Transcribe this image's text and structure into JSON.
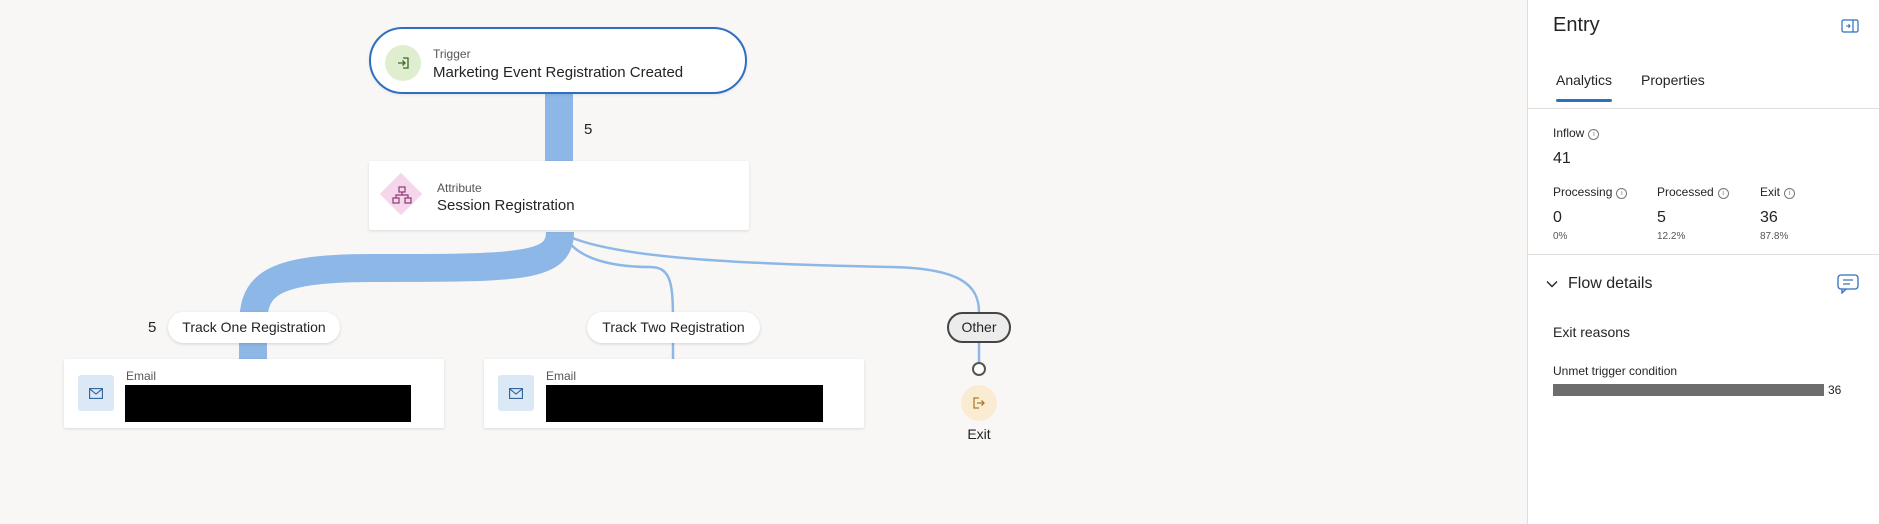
{
  "trigger": {
    "kind": "Trigger",
    "title": "Marketing Event Registration Created",
    "count": "5"
  },
  "attribute": {
    "kind": "Attribute",
    "title": "Session Registration"
  },
  "branches": [
    {
      "label": "Track One Registration",
      "count": "5"
    },
    {
      "label": "Track Two Registration"
    },
    {
      "label": "Other"
    }
  ],
  "emails": [
    {
      "kind": "Email"
    },
    {
      "kind": "Email"
    }
  ],
  "exit": {
    "label": "Exit"
  },
  "panel": {
    "title": "Entry",
    "tabs": [
      {
        "label": "Analytics",
        "active": true
      },
      {
        "label": "Properties",
        "active": false
      }
    ],
    "inflow": {
      "label": "Inflow",
      "value": "41"
    },
    "metrics": [
      {
        "label": "Processing",
        "value": "0",
        "pct": "0%"
      },
      {
        "label": "Processed",
        "value": "5",
        "pct": "12.2%"
      },
      {
        "label": "Exit",
        "value": "36",
        "pct": "87.8%"
      }
    ],
    "flow_details": "Flow details",
    "exit_reasons": {
      "title": "Exit reasons",
      "items": [
        {
          "label": "Unmet trigger condition",
          "value": "36"
        }
      ]
    }
  },
  "colors": {
    "accent": "#2f6fbf",
    "flow": "#8db7e6",
    "bar": "#6d6d6d"
  },
  "icons": [
    "enter-icon",
    "hierarchy-icon",
    "mail-icon",
    "exit-icon",
    "info-icon",
    "chevron-down-icon",
    "chat-icon",
    "collapse-panel-icon"
  ]
}
